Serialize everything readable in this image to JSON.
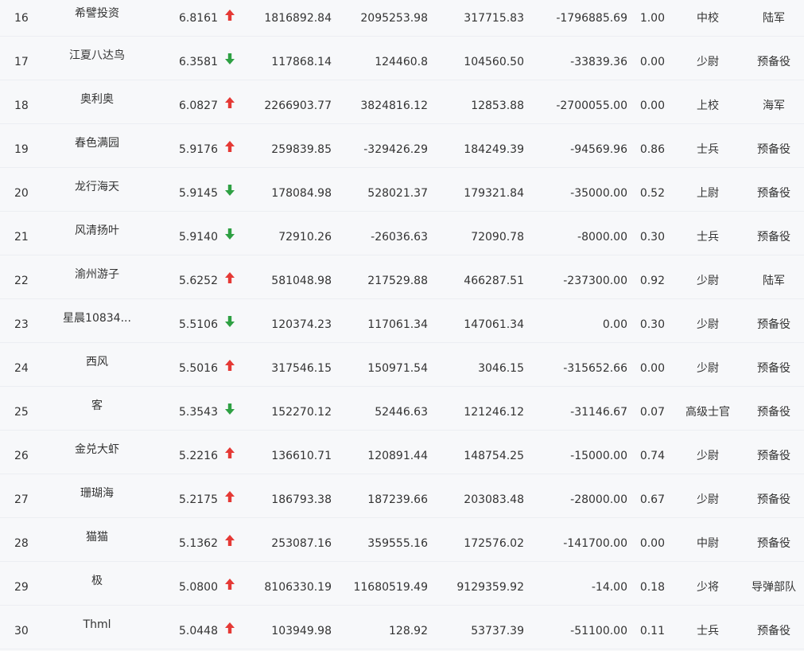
{
  "colors": {
    "up": "#e53935",
    "down": "#2ea043",
    "background": "#f7f8fa"
  },
  "rows": [
    {
      "rank": "16",
      "name": "希譬投资",
      "score": "6.8161",
      "dir": "up",
      "c1": "1816892.84",
      "c2": "2095253.98",
      "c3": "317715.83",
      "c4": "-1796885.69",
      "c5": "1.00",
      "title": "中校",
      "branch": "陆军"
    },
    {
      "rank": "17",
      "name": "江夏八达鸟",
      "score": "6.3581",
      "dir": "down",
      "c1": "117868.14",
      "c2": "124460.8",
      "c3": "104560.50",
      "c4": "-33839.36",
      "c5": "0.00",
      "title": "少尉",
      "branch": "预备役"
    },
    {
      "rank": "18",
      "name": "奥利奥",
      "score": "6.0827",
      "dir": "up",
      "c1": "2266903.77",
      "c2": "3824816.12",
      "c3": "12853.88",
      "c4": "-2700055.00",
      "c5": "0.00",
      "title": "上校",
      "branch": "海军"
    },
    {
      "rank": "19",
      "name": "春色满园",
      "score": "5.9176",
      "dir": "up",
      "c1": "259839.85",
      "c2": "-329426.29",
      "c3": "184249.39",
      "c4": "-94569.96",
      "c5": "0.86",
      "title": "士兵",
      "branch": "预备役"
    },
    {
      "rank": "20",
      "name": "龙行海天",
      "score": "5.9145",
      "dir": "down",
      "c1": "178084.98",
      "c2": "528021.37",
      "c3": "179321.84",
      "c4": "-35000.00",
      "c5": "0.52",
      "title": "上尉",
      "branch": "预备役"
    },
    {
      "rank": "21",
      "name": "风清扬叶",
      "score": "5.9140",
      "dir": "down",
      "c1": "72910.26",
      "c2": "-26036.63",
      "c3": "72090.78",
      "c4": "-8000.00",
      "c5": "0.30",
      "title": "士兵",
      "branch": "预备役"
    },
    {
      "rank": "22",
      "name": "渝州游子",
      "score": "5.6252",
      "dir": "up",
      "c1": "581048.98",
      "c2": "217529.88",
      "c3": "466287.51",
      "c4": "-237300.00",
      "c5": "0.92",
      "title": "少尉",
      "branch": "陆军"
    },
    {
      "rank": "23",
      "name": "星晨10834...",
      "score": "5.5106",
      "dir": "down",
      "c1": "120374.23",
      "c2": "117061.34",
      "c3": "147061.34",
      "c4": "0.00",
      "c5": "0.30",
      "title": "少尉",
      "branch": "预备役"
    },
    {
      "rank": "24",
      "name": "西风",
      "score": "5.5016",
      "dir": "up",
      "c1": "317546.15",
      "c2": "150971.54",
      "c3": "3046.15",
      "c4": "-315652.66",
      "c5": "0.00",
      "title": "少尉",
      "branch": "预备役"
    },
    {
      "rank": "25",
      "name": "客",
      "score": "5.3543",
      "dir": "down",
      "c1": "152270.12",
      "c2": "52446.63",
      "c3": "121246.12",
      "c4": "-31146.67",
      "c5": "0.07",
      "title": "高级士官",
      "branch": "预备役"
    },
    {
      "rank": "26",
      "name": "金兑大虾",
      "score": "5.2216",
      "dir": "up",
      "c1": "136610.71",
      "c2": "120891.44",
      "c3": "148754.25",
      "c4": "-15000.00",
      "c5": "0.74",
      "title": "少尉",
      "branch": "预备役"
    },
    {
      "rank": "27",
      "name": "珊瑚海",
      "score": "5.2175",
      "dir": "up",
      "c1": "186793.38",
      "c2": "187239.66",
      "c3": "203083.48",
      "c4": "-28000.00",
      "c5": "0.67",
      "title": "少尉",
      "branch": "预备役"
    },
    {
      "rank": "28",
      "name": "猫猫",
      "score": "5.1362",
      "dir": "up",
      "c1": "253087.16",
      "c2": "359555.16",
      "c3": "172576.02",
      "c4": "-141700.00",
      "c5": "0.00",
      "title": "中尉",
      "branch": "预备役"
    },
    {
      "rank": "29",
      "name": "极",
      "score": "5.0800",
      "dir": "up",
      "c1": "8106330.19",
      "c2": "11680519.49",
      "c3": "9129359.92",
      "c4": "-14.00",
      "c5": "0.18",
      "title": "少将",
      "branch": "导弹部队"
    },
    {
      "rank": "30",
      "name": "Thml",
      "score": "5.0448",
      "dir": "up",
      "c1": "103949.98",
      "c2": "128.92",
      "c3": "53737.39",
      "c4": "-51100.00",
      "c5": "0.11",
      "title": "士兵",
      "branch": "预备役"
    }
  ]
}
